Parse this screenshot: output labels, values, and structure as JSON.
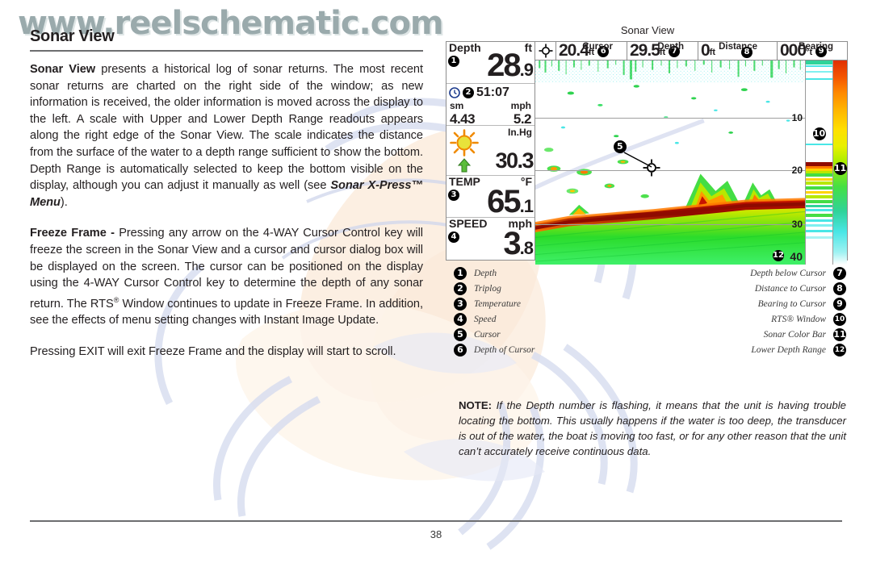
{
  "watermark": "www.reelschematic.com",
  "page": {
    "title": "Sonar View",
    "number": "38"
  },
  "body": {
    "p1_lead": "Sonar View",
    "p1": " presents a historical log of sonar returns. The most recent sonar returns are charted on the right side of the window; as new information is received, the older information is moved across the display to the left. A scale with Upper and Lower Depth Range readouts appears along the right edge of the Sonar View. The scale indicates the distance from the surface of the water to a depth range sufficient to show the bottom. Depth Range is automatically selected to keep the bottom visible on the display, although you can adjust it manually as well (see ",
    "p1_ref": "Sonar X-Press™ Menu",
    "p1_end": ").",
    "p2_lead": "Freeze Frame - ",
    "p2a": "Pressing any arrow on the 4-WAY Cursor Control key will freeze the screen in the Sonar View and a cursor and cursor dialog box will be displayed on the screen. The cursor can be positioned on the display using the 4-WAY Cursor Control key to determine the depth of any sonar return. The RTS",
    "p2_sup": "®",
    "p2b": " Window continues to update in Freeze Frame. In addition, see the effects of menu setting changes with Instant Image Update.",
    "p3": "Pressing EXIT will exit Freeze Frame and the display will start to scroll."
  },
  "figure": {
    "caption": "Sonar View"
  },
  "device": {
    "depth": {
      "label": "Depth",
      "unit": "ft",
      "callout": "1",
      "value_int": "28",
      "value_dec": ".9"
    },
    "triplog": {
      "callout": "2",
      "clock_icon": "clock-icon",
      "time": "51:07",
      "dist_unit": "sm",
      "speed_unit": "mph",
      "dist_value": "4.43",
      "speed_value": "5.2"
    },
    "weather": {
      "icon": "sun-icon",
      "trend_icon": "up-arrow-icon",
      "unit": "In.Hg",
      "value": "30.3"
    },
    "temp": {
      "label": "TEMP",
      "unit": "°F",
      "callout": "3",
      "value_int": "65",
      "value_dec": ".1"
    },
    "speed": {
      "label": "SPEED",
      "unit": "mph",
      "callout": "4",
      "value_int": "3",
      "value_dec": ".8"
    },
    "topbar": {
      "cursor_icon": "crosshair-icon",
      "cells": [
        {
          "value": "20.4",
          "unit": "ft",
          "label": "Cursor",
          "callout": "6"
        },
        {
          "value": "29.5",
          "unit": "ft",
          "label": "Depth",
          "callout": "7"
        },
        {
          "value": "0",
          "unit": "ft",
          "label": "Distance",
          "callout": "8"
        },
        {
          "value": "000",
          "unit": "°t",
          "label": "Bearing",
          "callout": "9"
        }
      ]
    },
    "scale": {
      "upper": "",
      "ticks": [
        "10",
        "20",
        "30"
      ],
      "lower": "40",
      "lower_callout": "12"
    },
    "cursor_marker": {
      "callout": "5",
      "icon": "crosshair-icon"
    },
    "rts_callout": "10",
    "colorbar_callout": "11"
  },
  "legend_left": [
    {
      "n": "1",
      "label": "Depth"
    },
    {
      "n": "2",
      "label": "Triplog"
    },
    {
      "n": "3",
      "label": "Temperature"
    },
    {
      "n": "4",
      "label": "Speed"
    },
    {
      "n": "5",
      "label": "Cursor"
    },
    {
      "n": "6",
      "label": "Depth of Cursor"
    }
  ],
  "legend_right": [
    {
      "n": "7",
      "label": "Depth below Cursor"
    },
    {
      "n": "8",
      "label": "Distance to Cursor"
    },
    {
      "n": "9",
      "label": "Bearing to Cursor"
    },
    {
      "n": "10",
      "label": "RTS® Window"
    },
    {
      "n": "11",
      "label": "Sonar Color Bar"
    },
    {
      "n": "12",
      "label": "Lower Depth Range"
    }
  ],
  "note": {
    "lead": "NOTE:",
    "text": " If the Depth number is flashing, it means that the unit is having trouble locating the bottom. This usually happens if the water is too deep, the transducer is out of the water, the boat is moving too fast, or for any other reason that the unit can’t accurately receive continuous data."
  },
  "colors": {
    "watermark": "#7e9396",
    "rule": "#6d6e70",
    "sonar_bottom": "#a31100",
    "sonar_mid": "#ffd400",
    "sonar_weak": "#00cc22",
    "sonar_faint": "#49e6e6"
  }
}
